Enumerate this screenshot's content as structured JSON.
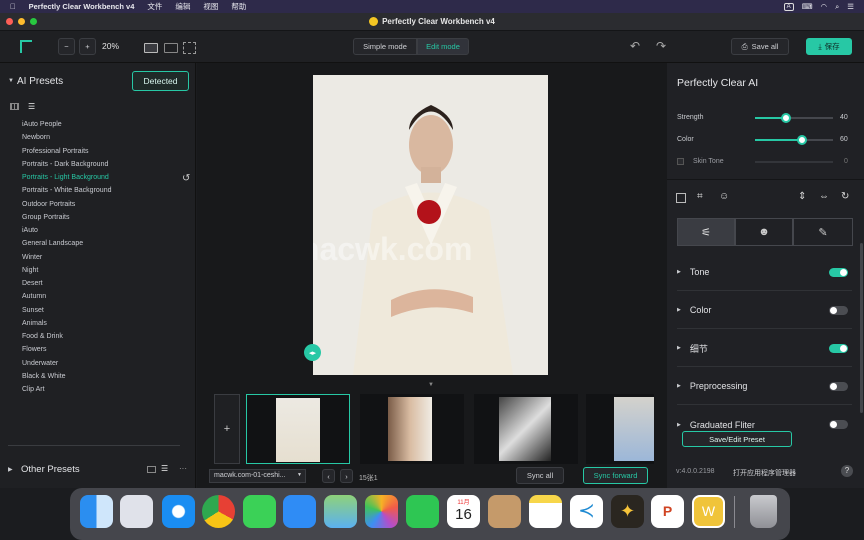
{
  "menubar": {
    "app": "Perfectly Clear Workbench v4",
    "items": [
      "文件",
      "编辑",
      "视图",
      "帮助"
    ]
  },
  "window": {
    "title": "Perfectly Clear Workbench v4"
  },
  "toolbar": {
    "zoom": "20%",
    "simple_mode": "Simple mode",
    "edit_mode": "Edit mode",
    "save_all": "Save all",
    "save": "保存"
  },
  "left": {
    "ai_presets_title": "AI Presets",
    "detected": "Detected",
    "presets": [
      "iAuto People",
      "Newborn",
      "Professional Portraits",
      "Portraits - Dark Background",
      "Portraits - Light Background",
      "Portraits - White Background",
      "Outdoor Portraits",
      "Group Portraits",
      "iAuto",
      "General Landscape",
      "Winter",
      "Night",
      "Desert",
      "Autumn",
      "Sunset",
      "Animals",
      "Food & Drink",
      "Flowers",
      "Underwater",
      "Black & White",
      "Clip Art"
    ],
    "active_index": 4,
    "other_presets": "Other Presets"
  },
  "center": {
    "watermark": "macwk.com",
    "filename": "macwk.com-01-ceshi...",
    "count": "15张1",
    "sync_all": "Sync all",
    "sync_forward": "Sync forward",
    "add": "+"
  },
  "right": {
    "title": "Perfectly Clear AI",
    "sliders": [
      {
        "label": "Strength",
        "value": "40"
      },
      {
        "label": "Color",
        "value": "60"
      },
      {
        "label": "Skin Tone",
        "value": "0"
      }
    ],
    "levels": {
      "strength": 0.4,
      "color": 0.6,
      "skin_tone": 0.0
    },
    "sections": [
      {
        "label": "Tone",
        "on": true
      },
      {
        "label": "Color",
        "on": false
      },
      {
        "label": "细节",
        "on": true
      },
      {
        "label": "Preprocessing",
        "on": false
      },
      {
        "label": "Graduated Fliter",
        "on": false
      }
    ],
    "save_edit_preset": "Save/Edit Preset",
    "version": "v:4.0.0.2198",
    "open_manager": "打开应用程序管理器",
    "help": "?"
  },
  "dock": {
    "calendar_month": "11月",
    "calendar_day": "16"
  },
  "colors": {
    "accent": "#27c8a5",
    "menubar": "#2e2a4a",
    "panel": "#1f2023"
  }
}
